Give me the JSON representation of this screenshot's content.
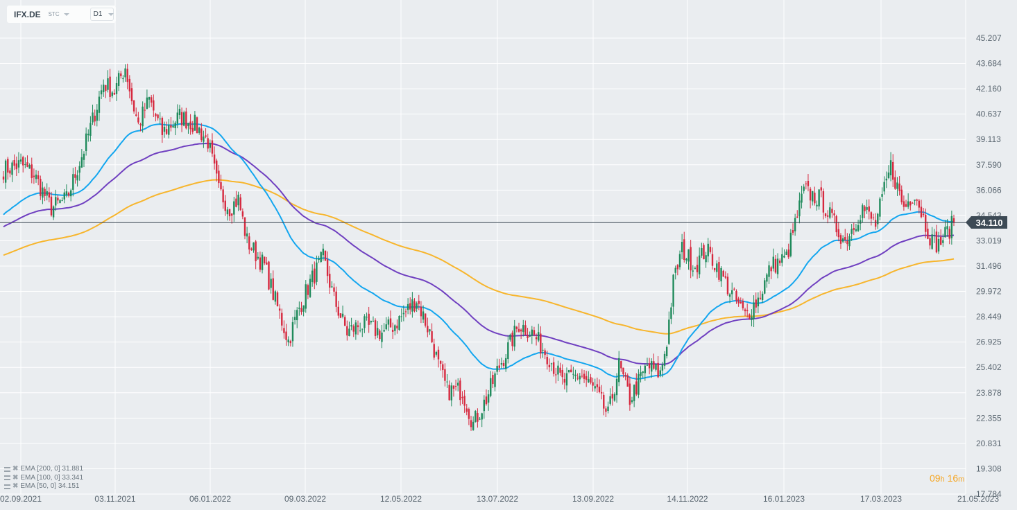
{
  "toolbar": {
    "symbol": "IFX.DE",
    "market": "STC",
    "timeframe": "D1"
  },
  "current_price_label": "34.110",
  "timer": {
    "hours": "09",
    "h": "h",
    "minutes": "16",
    "m": "m"
  },
  "legend": [
    {
      "label": "EMA [200,  0] 31.881"
    },
    {
      "label": "EMA [100,  0] 33.341"
    },
    {
      "label": "EMA [50,  0] 34.151"
    }
  ],
  "colors": {
    "up": "#1f8a5b",
    "down": "#d6283e",
    "ema50": "#13a6ef",
    "ema100": "#6f3fc0",
    "ema200": "#f7b52c",
    "price_line": "#3d4a55"
  },
  "chart_data": {
    "type": "candlestick",
    "symbol": "IFX.DE",
    "current_price": 34.11,
    "ylim": [
      17.784,
      45.207
    ],
    "y_ticks": [
      "45.207",
      "43.684",
      "42.160",
      "40.637",
      "39.113",
      "37.590",
      "36.066",
      "34.543",
      "33.019",
      "31.496",
      "29.972",
      "28.449",
      "26.925",
      "25.402",
      "23.878",
      "22.355",
      "20.831",
      "19.308",
      "17.784"
    ],
    "x_ticks": [
      "02.09.2021",
      "03.11.2021",
      "06.01.2022",
      "09.03.2022",
      "12.05.2022",
      "13.07.2022",
      "13.09.2022",
      "14.11.2022",
      "16.01.2023",
      "17.03.2023",
      "21.05.2023"
    ],
    "grid": true,
    "close_path_by_trading_day": [
      [
        0,
        37.3
      ],
      [
        8,
        37.6
      ],
      [
        14,
        37.0
      ],
      [
        22,
        35.0
      ],
      [
        29,
        35.5
      ],
      [
        37,
        38.5
      ],
      [
        46,
        42.5
      ],
      [
        51,
        42.0
      ],
      [
        56,
        43.5
      ],
      [
        59,
        41.5
      ],
      [
        62,
        40.0
      ],
      [
        67,
        41.5
      ],
      [
        73,
        39.5
      ],
      [
        81,
        40.5
      ],
      [
        88,
        40.0
      ],
      [
        94,
        39.0
      ],
      [
        99,
        36.0
      ],
      [
        104,
        35.0
      ],
      [
        108,
        35.5
      ],
      [
        112,
        33.0
      ],
      [
        120,
        31.5
      ],
      [
        126,
        29.0
      ],
      [
        131,
        27.0
      ],
      [
        136,
        29.0
      ],
      [
        141,
        30.5
      ],
      [
        147,
        32.0
      ],
      [
        152,
        29.5
      ],
      [
        158,
        27.5
      ],
      [
        164,
        28.0
      ],
      [
        174,
        27.5
      ],
      [
        180,
        28.0
      ],
      [
        190,
        29.5
      ],
      [
        196,
        27.5
      ],
      [
        200,
        25.5
      ],
      [
        204,
        24.0
      ],
      [
        211,
        24.0
      ],
      [
        216,
        22.0
      ],
      [
        222,
        23.5
      ],
      [
        228,
        25.5
      ],
      [
        233,
        26.8
      ],
      [
        237,
        28.0
      ],
      [
        243,
        27.5
      ],
      [
        251,
        26.0
      ],
      [
        257,
        24.5
      ],
      [
        265,
        25.0
      ],
      [
        272,
        24.0
      ],
      [
        278,
        22.5
      ],
      [
        283,
        25.5
      ],
      [
        288,
        23.5
      ],
      [
        296,
        25.5
      ],
      [
        302,
        25.0
      ],
      [
        305,
        27.0
      ],
      [
        308,
        30.5
      ],
      [
        312,
        32.5
      ],
      [
        318,
        31.5
      ],
      [
        323,
        32.5
      ],
      [
        328,
        31.5
      ],
      [
        334,
        30.0
      ],
      [
        341,
        28.5
      ],
      [
        347,
        29.5
      ],
      [
        353,
        31.5
      ],
      [
        360,
        32.0
      ],
      [
        363,
        33.5
      ],
      [
        368,
        36.0
      ],
      [
        376,
        35.5
      ],
      [
        382,
        34.0
      ],
      [
        387,
        33.0
      ],
      [
        395,
        35.0
      ],
      [
        401,
        34.0
      ],
      [
        408,
        37.5
      ],
      [
        414,
        35.0
      ],
      [
        419,
        36.0
      ],
      [
        424,
        34.0
      ],
      [
        427,
        33.0
      ],
      [
        430,
        32.8
      ],
      [
        437,
        34.1
      ]
    ],
    "series": [
      {
        "name": "EMA [200, 0]",
        "last": 31.881,
        "start": 32.1
      },
      {
        "name": "EMA [100, 0]",
        "last": 33.341,
        "start": 33.8
      },
      {
        "name": "EMA [50, 0]",
        "last": 34.151,
        "start": 34.5
      }
    ]
  }
}
